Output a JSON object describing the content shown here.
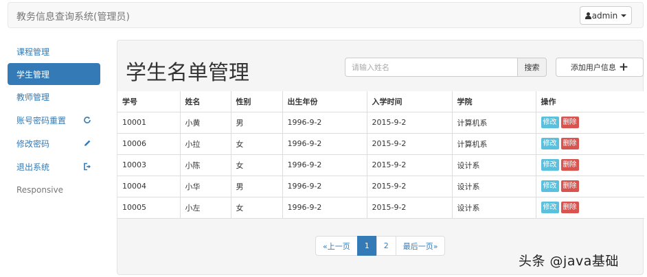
{
  "navbar": {
    "brand": "教务信息查询系统(管理员)",
    "user_label": "admin"
  },
  "sidebar": {
    "items": [
      {
        "label": "课程管理",
        "icon": ""
      },
      {
        "label": "学生管理",
        "icon": "",
        "active": true
      },
      {
        "label": "教师管理",
        "icon": ""
      },
      {
        "label": "账号密码重置",
        "icon": "refresh-icon"
      },
      {
        "label": "修改密码",
        "icon": "pencil-icon"
      },
      {
        "label": "退出系统",
        "icon": "log-out-icon"
      },
      {
        "label": "Responsive",
        "icon": ""
      }
    ]
  },
  "main": {
    "title": "学生名单管理",
    "search_placeholder": "请输入姓名",
    "search_button": "搜索",
    "add_button": "添加用户信息",
    "table": {
      "headers": [
        "学号",
        "姓名",
        "性别",
        "出生年份",
        "入学时间",
        "学院",
        "操作"
      ],
      "rows": [
        [
          "10001",
          "小黄",
          "男",
          "1996-9-2",
          "2015-9-2",
          "计算机系"
        ],
        [
          "10006",
          "小拉",
          "女",
          "1996-9-2",
          "2015-9-2",
          "计算机系"
        ],
        [
          "10003",
          "小陈",
          "女",
          "1996-9-2",
          "2015-9-2",
          "设计系"
        ],
        [
          "10004",
          "小华",
          "男",
          "1996-9-2",
          "2015-9-2",
          "设计系"
        ],
        [
          "10005",
          "小左",
          "女",
          "1996-9-2",
          "2015-9-2",
          "设计系"
        ]
      ],
      "edit_label": "修改",
      "delete_label": "删除"
    },
    "pagination": {
      "prev": "«上一页",
      "pages": [
        "1",
        "2"
      ],
      "current": "1",
      "last": "最后一页»"
    }
  },
  "watermark": "头条 @java基础",
  "colors": {
    "primary": "#337ab7",
    "info": "#5bc0de",
    "danger": "#d9534f"
  }
}
